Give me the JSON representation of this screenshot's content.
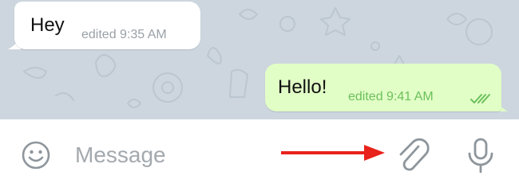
{
  "messages": {
    "incoming": {
      "text": "Hey",
      "meta": "edited 9:35 AM"
    },
    "outgoing": {
      "text": "Hello!",
      "meta": "edited 9:41 AM",
      "status_icon": "double-check-icon"
    }
  },
  "composer": {
    "placeholder": "Message",
    "emoji_icon": "emoji-icon",
    "attach_icon": "paperclip-icon",
    "mic_icon": "microphone-icon"
  },
  "colors": {
    "chat_background": "#cdd6df",
    "incoming_bubble": "#ffffff",
    "outgoing_bubble": "#e1fec6",
    "outgoing_meta": "#6cbf5c",
    "annotation_arrow": "#e8231b",
    "icon_gray": "#8e969c"
  }
}
